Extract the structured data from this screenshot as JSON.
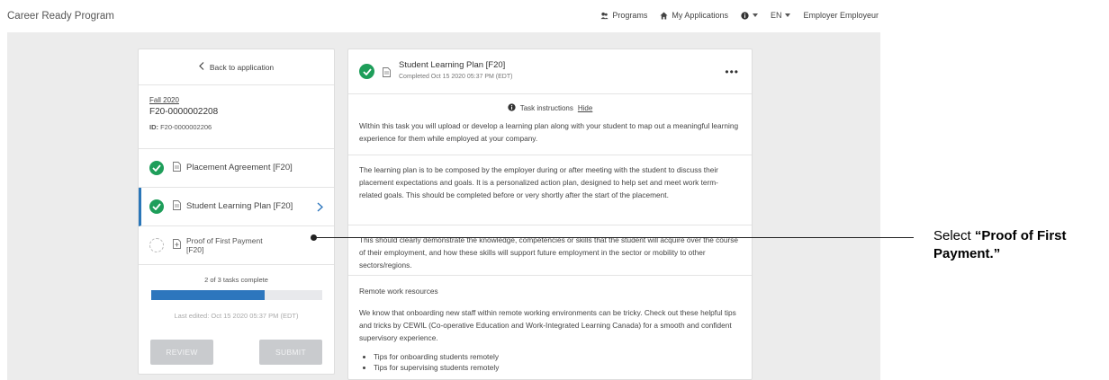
{
  "topbar": {
    "brand": "Career Ready Program",
    "programs": "Programs",
    "my_applications": "My Applications",
    "language": "EN",
    "user": "Employer Employeur"
  },
  "left": {
    "back_label": "Back to application",
    "term": "Fall 2020",
    "app_number": "F20-0000002208",
    "id_label": "ID:",
    "id_value": "F20-0000002206",
    "tasks": [
      {
        "label": "Placement Agreement [F20]",
        "status": "complete"
      },
      {
        "label": "Student Learning Plan [F20]",
        "status": "complete"
      },
      {
        "label": "Proof of First Payment [F20]",
        "status": "incomplete"
      }
    ],
    "progress_text": "2 of 3 tasks complete",
    "progress_fraction": 0.667,
    "last_edited": "Last edited: Oct 15 2020 05:37 PM (EDT)",
    "review_label": "REVIEW",
    "submit_label": "SUBMIT"
  },
  "right": {
    "title": "Student Learning Plan [F20]",
    "completed": "Completed Oct 15 2020 05:37 PM (EDT)",
    "menu": "•••",
    "instructions_label": "Task instructions",
    "hide_label": "Hide",
    "p1": "Within this task you will upload or develop a learning plan along with your student to map out a meaningful learning experience for them while employed at your company.",
    "p2": "The learning plan is to be composed by the employer during or after meeting with the student to discuss their placement expectations and goals. It is a personalized action plan, designed to help set and meet work term-related goals. This should be completed before or very shortly after the start of the placement.",
    "p3": "This should clearly demonstrate the knowledge, competencies or skills that the student will acquire over the course of their employment, and how these skills will support future employment in the sector or mobility to other sectors/regions.",
    "remote_heading": "Remote work resources",
    "p5": "We know that onboarding new staff within remote working environments can be tricky.  Check out these helpful tips and tricks by CEWIL (Co-operative Education and Work-Integrated Learning Canada) for a smooth and confident supervisory experience.",
    "bullets": [
      "Tips for onboarding students remotely",
      "Tips for supervising students remotely"
    ]
  },
  "annotation": {
    "prefix": "Select ",
    "bold": "“Proof of First Payment.”"
  },
  "colors": {
    "accent": "#2d76bd",
    "success": "#1e9e5a",
    "canvas": "#ececec",
    "button_disabled": "#c9cbce"
  }
}
